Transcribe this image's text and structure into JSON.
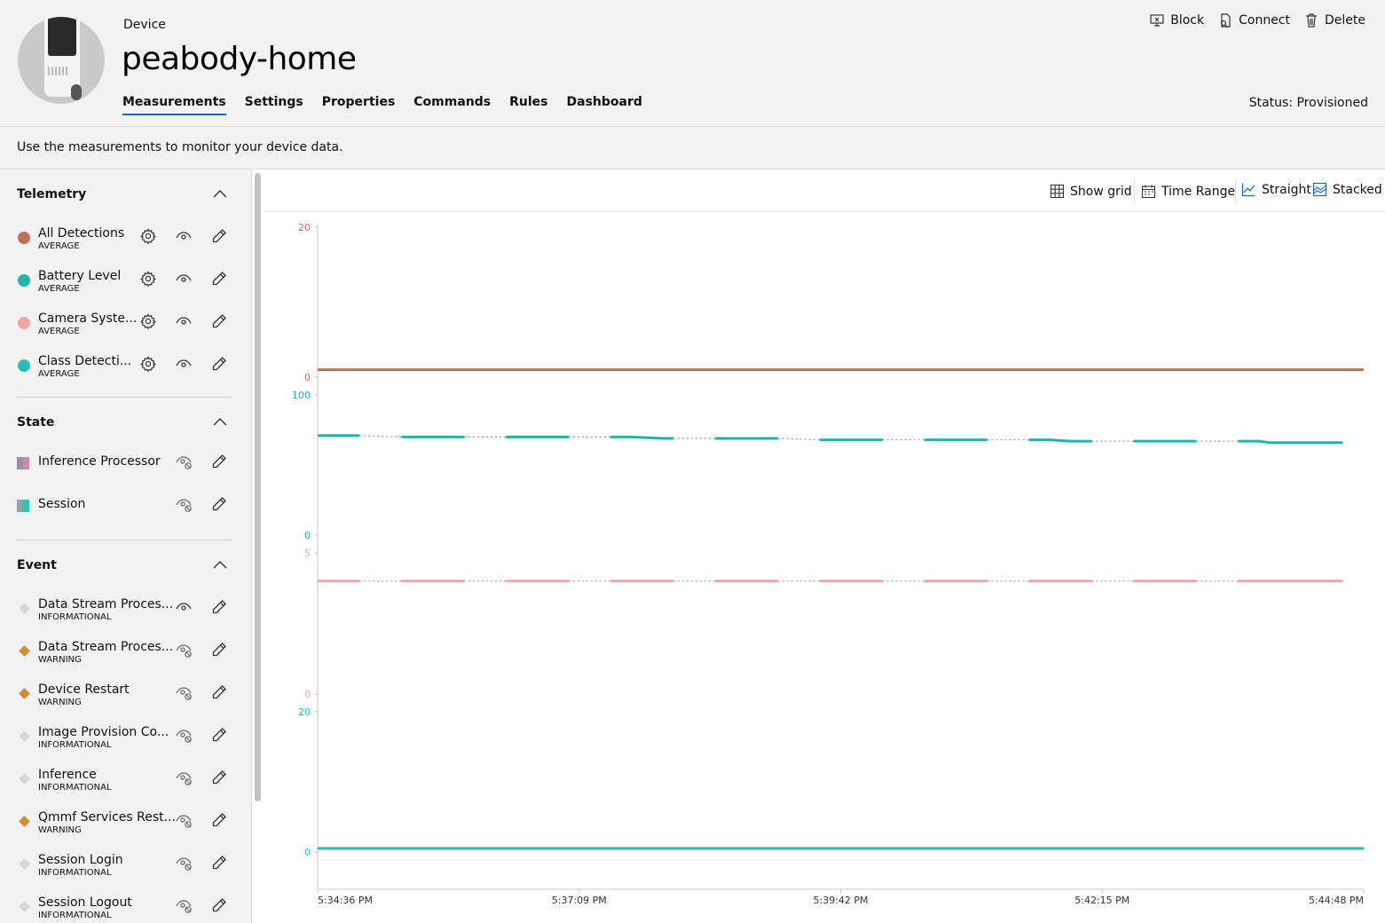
{
  "header": {
    "label": "Device",
    "device_name": "peabody-home",
    "status": "Status: Provisioned",
    "actions": [
      {
        "label": "Block",
        "icon": "block-icon"
      },
      {
        "label": "Connect",
        "icon": "connect-icon"
      },
      {
        "label": "Delete",
        "icon": "trash-icon"
      }
    ],
    "tabs": [
      "Measurements",
      "Settings",
      "Properties",
      "Commands",
      "Rules",
      "Dashboard"
    ],
    "active_tab": "Measurements"
  },
  "info_text": "Use the measurements to monitor your device data.",
  "sidebar": {
    "telemetry": {
      "title": "Telemetry",
      "items": [
        {
          "name": "All Detections",
          "sub": "AVERAGE",
          "color": "#c0705a"
        },
        {
          "name": "Battery Level",
          "sub": "AVERAGE",
          "color": "#1fb5ad"
        },
        {
          "name": "Camera Syste...",
          "sub": "AVERAGE",
          "color": "#f4a4a4"
        },
        {
          "name": "Class Detecti...",
          "sub": "AVERAGE",
          "color": "#2bbcb4"
        }
      ]
    },
    "state": {
      "title": "State",
      "items": [
        {
          "name": "Inference Processor",
          "colors": [
            "#9a8fa6",
            "#d08aa8"
          ]
        },
        {
          "name": "Session",
          "colors": [
            "#8fa6a8",
            "#2bc4b6"
          ]
        }
      ]
    },
    "event": {
      "title": "Event",
      "items": [
        {
          "name": "Data Stream Proces...",
          "sub": "INFORMATIONAL",
          "color": "#d6d6d6",
          "visible": true
        },
        {
          "name": "Data Stream Proces...",
          "sub": "WARNING",
          "color": "#d78a2e",
          "visible": false
        },
        {
          "name": "Device Restart",
          "sub": "WARNING",
          "color": "#d78a2e",
          "visible": false
        },
        {
          "name": "Image Provision Co...",
          "sub": "INFORMATIONAL",
          "color": "#d6d6d6",
          "visible": false
        },
        {
          "name": "Inference",
          "sub": "INFORMATIONAL",
          "color": "#d6d6d6",
          "visible": false
        },
        {
          "name": "Qmmf Services Rest...",
          "sub": "WARNING",
          "color": "#d78a2e",
          "visible": false
        },
        {
          "name": "Session Login",
          "sub": "INFORMATIONAL",
          "color": "#d6d6d6",
          "visible": false
        },
        {
          "name": "Session Logout",
          "sub": "INFORMATIONAL",
          "color": "#d6d6d6",
          "visible": false
        }
      ]
    }
  },
  "toolbar": {
    "show_grid": "Show grid",
    "time_range": "Time Range",
    "straight": "Straight",
    "stacked": "Stacked"
  },
  "chart_data": {
    "type": "line",
    "layout": "stacked",
    "x_ticks": [
      "5:34:36 PM",
      "5:37:09 PM",
      "5:39:42 PM",
      "5:42:15 PM",
      "5:44:48 PM"
    ],
    "panels": [
      {
        "series": "All Detections",
        "color": "#c0705a",
        "ylim": [
          0,
          20
        ],
        "ticks": [
          "20",
          "0"
        ],
        "segments": [
          [
            [
              0,
              1
            ],
            [
              100,
              1
            ]
          ]
        ]
      },
      {
        "series": "Battery Level",
        "color": "#1fb5ad",
        "ylim": [
          0,
          100
        ],
        "ticks": [
          "100",
          "0"
        ],
        "segments": [
          [
            [
              0,
              71
            ],
            [
              4,
              71
            ]
          ],
          [
            [
              8,
              70
            ],
            [
              14,
              70
            ]
          ],
          [
            [
              18,
              70
            ],
            [
              24,
              70
            ]
          ],
          [
            [
              28,
              70
            ],
            [
              30,
              70
            ],
            [
              33,
              69
            ],
            [
              34,
              69
            ]
          ],
          [
            [
              38,
              69
            ],
            [
              44,
              69
            ]
          ],
          [
            [
              48,
              68
            ],
            [
              54,
              68
            ]
          ],
          [
            [
              58,
              68
            ],
            [
              64,
              68
            ]
          ],
          [
            [
              68,
              68
            ],
            [
              70,
              68
            ],
            [
              72,
              67
            ],
            [
              74,
              67
            ]
          ],
          [
            [
              78,
              67
            ],
            [
              84,
              67
            ]
          ],
          [
            [
              88,
              67
            ],
            [
              90,
              67
            ],
            [
              91,
              66
            ],
            [
              98,
              66
            ]
          ]
        ]
      },
      {
        "series": "Camera Syste...",
        "color": "#f4a4a4",
        "ylim": [
          0,
          5
        ],
        "ticks": [
          "5",
          "0"
        ],
        "segments": [
          [
            [
              0,
              4
            ],
            [
              4,
              4
            ]
          ],
          [
            [
              8,
              4
            ],
            [
              14,
              4
            ]
          ],
          [
            [
              18,
              4
            ],
            [
              24,
              4
            ]
          ],
          [
            [
              28,
              4
            ],
            [
              34,
              4
            ]
          ],
          [
            [
              38,
              4
            ],
            [
              44,
              4
            ]
          ],
          [
            [
              48,
              4
            ],
            [
              54,
              4
            ]
          ],
          [
            [
              58,
              4
            ],
            [
              64,
              4
            ]
          ],
          [
            [
              68,
              4
            ],
            [
              74,
              4
            ]
          ],
          [
            [
              78,
              4
            ],
            [
              84,
              4
            ]
          ],
          [
            [
              88,
              4
            ],
            [
              98,
              4
            ]
          ]
        ]
      },
      {
        "series": "Class Detecti...",
        "color": "#2bbcb4",
        "ylim": [
          0,
          20
        ],
        "ticks": [
          "20",
          "0"
        ],
        "segments": [
          [
            [
              0,
              0.5
            ],
            [
              100,
              0.5
            ]
          ]
        ]
      }
    ]
  }
}
